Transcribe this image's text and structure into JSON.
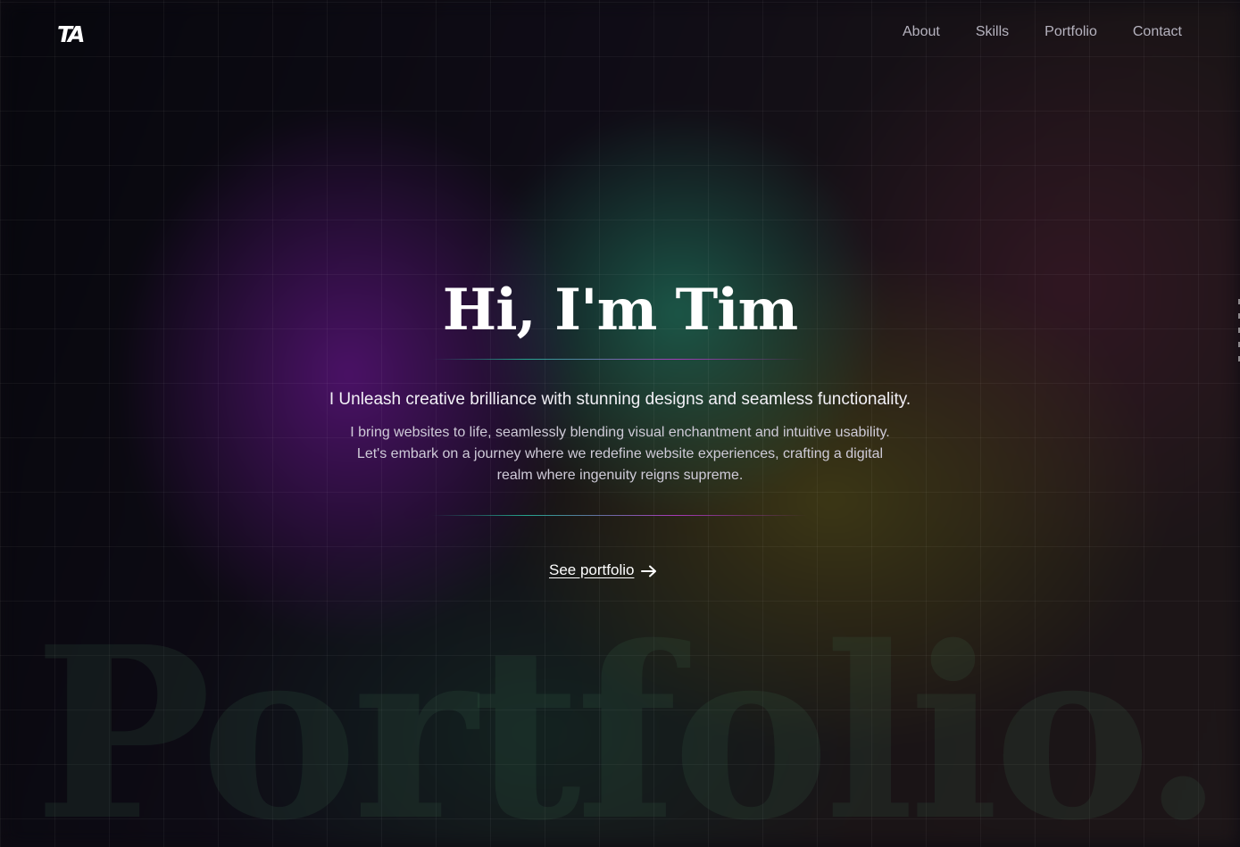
{
  "header": {
    "logo_text": "TA",
    "nav": [
      {
        "label": "About"
      },
      {
        "label": "Skills"
      },
      {
        "label": "Portfolio"
      },
      {
        "label": "Contact"
      }
    ]
  },
  "hero": {
    "title": "Hi, I'm Tim",
    "tagline": "I Unleash creative brilliance with stunning designs and seamless functionality.",
    "description": "I bring websites to life, seamlessly blending visual enchantment and intuitive usability. Let's embark on a journey where we redefine website experiences, crafting a digital realm where ingenuity reigns supreme.",
    "cta_label": "See portfolio",
    "cta_icon": "arrow-right-icon"
  },
  "watermark": "Portfolio.",
  "colors": {
    "background": "#0d0b12",
    "text": "#ffffff",
    "nav_text": "#b6b3bf",
    "accent_teal": "#28c8aa",
    "accent_purple": "#b43cc8"
  }
}
